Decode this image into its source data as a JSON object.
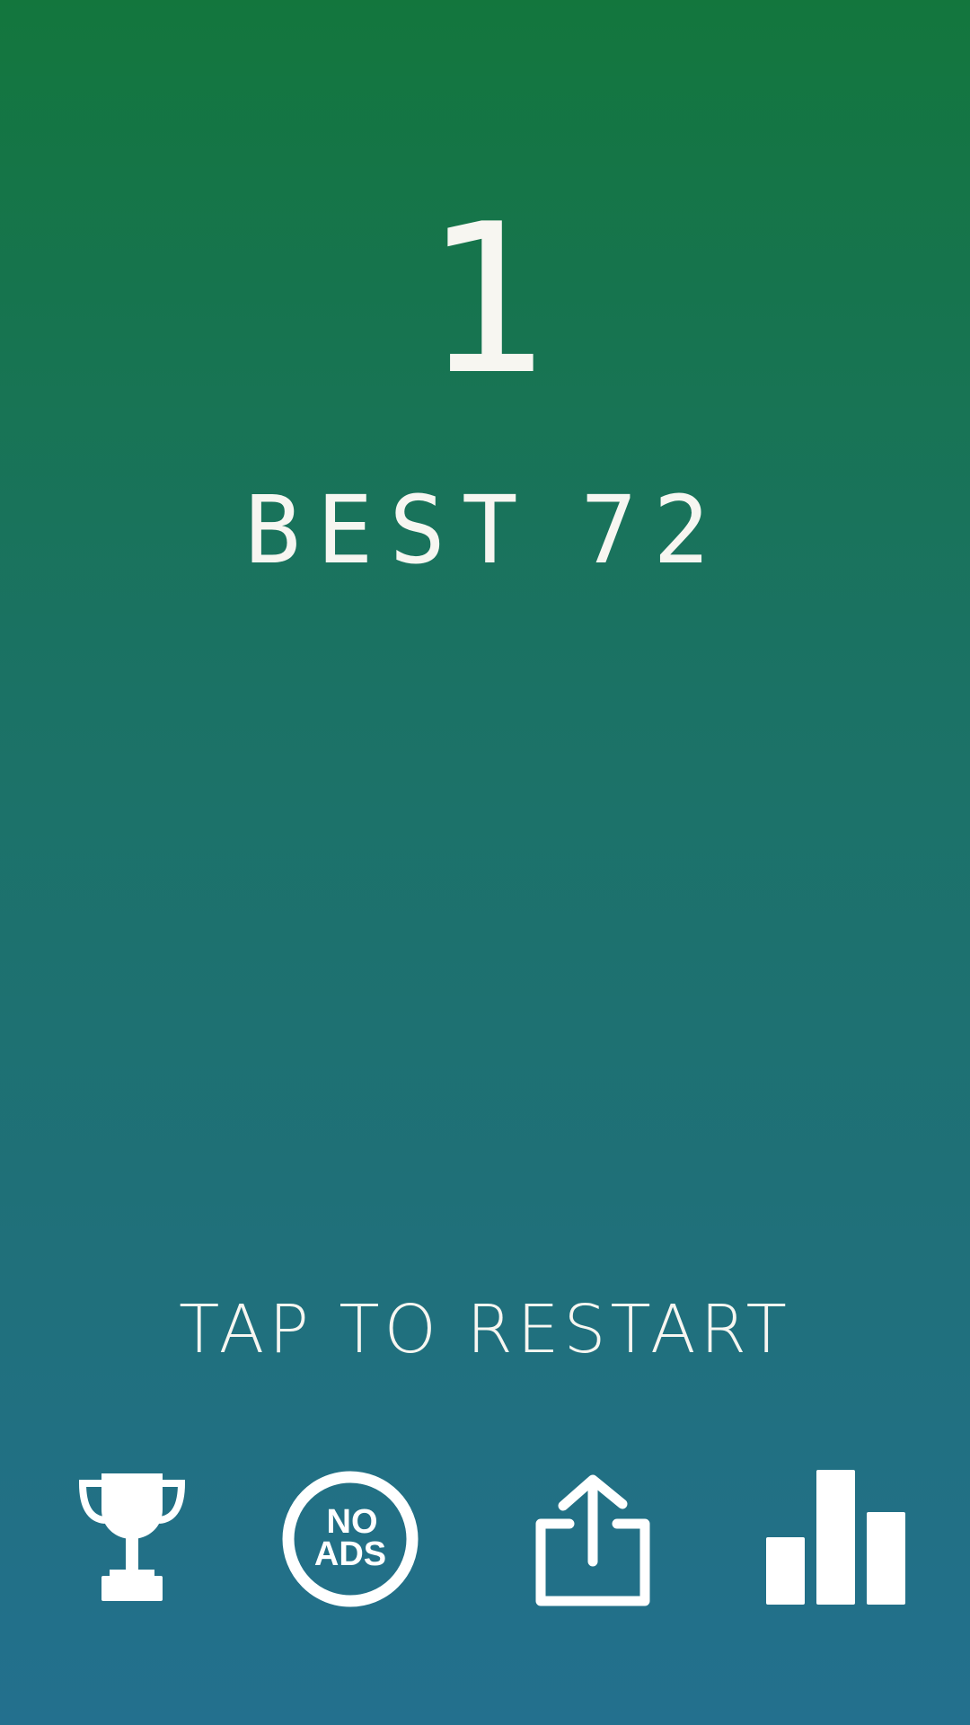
{
  "game": {
    "score": "1",
    "best_label": "BEST",
    "best_value": "72",
    "restart_label": "TAP TO RESTART"
  },
  "buttons": [
    {
      "icon": "trophy-icon",
      "action": "leaderboard"
    },
    {
      "icon": "no-ads-icon",
      "line1": "NO",
      "line2": "ADS"
    },
    {
      "icon": "share-icon",
      "action": "share"
    },
    {
      "icon": "bar-chart-icon",
      "action": "stats"
    }
  ],
  "colors": {
    "gradient_top": "#13763d",
    "gradient_bottom": "#23708e",
    "foreground": "#f7f6f1"
  }
}
